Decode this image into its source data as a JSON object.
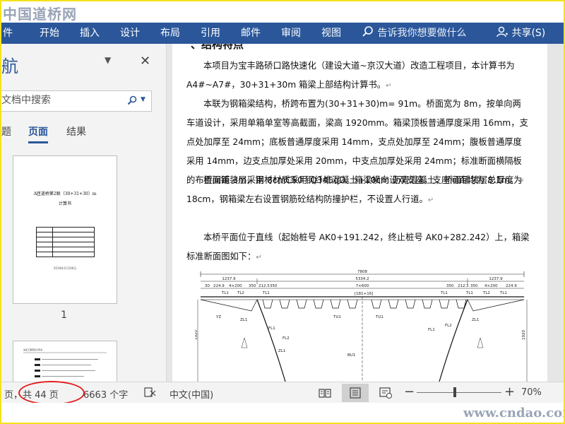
{
  "watermark": {
    "top": "中国道桥网",
    "bottom": "www.cndao.com"
  },
  "ribbon": {
    "tabs": [
      "件",
      "开始",
      "插入",
      "设计",
      "布局",
      "引用",
      "邮件",
      "审阅",
      "视图"
    ],
    "tell_me": "告诉我你想要做什么",
    "share": "共享(S)"
  },
  "nav": {
    "title": "航",
    "search_placeholder": "文档中搜索",
    "tabs": [
      "题",
      "页面",
      "结果"
    ],
    "thumb1": {
      "title": "A匝道桥第2联（30+31+30）m",
      "subtitle": "计算书",
      "date": "2018年11月06日",
      "page_number": "1"
    },
    "thumb2": {
      "header": "某某工程项目计算书"
    }
  },
  "document": {
    "heading": "、结构特点",
    "paragraphs": [
      "本项目为宝丰路硚口路快速化（建设大道~京汉大道）改造工程项目，本计算书为A4#~A7#，30+31+30m 箱梁上部结构计算书。",
      "本联为钢箱梁结构，桥跨布置为(30+31+30)m= 91m。桥面宽为 8m，按单向两车道设计，采用单箱单室等高截面，梁高 1920mm。箱梁顶板普通厚度采用 16mm，支点处加厚至 24mm；底板普通厚度采用 14mm，支点处加厚至 24mm；腹板普通厚度采用 14mm，边支点加厚处采用 20mm，中支点加厚处采用 24mm；标准断面横隔板的布置间距 3m，钢材材质采用 Q345qD。箱梁横向设双支座，支座间距均为 8.1m。",
      "桥面铺装层采用 8cmC50 钢纤维混凝土+10cm 沥青混凝土，桥面铺装层总厚度为18cm，钢箱梁左右设置钢筋砼结构防撞护栏，不设置人行道。",
      "本桥平面位于直线（起始桩号 AK0+191.242，终止桩号 AK0+282.242）上，箱梁标准断面图如下："
    ],
    "paragraph_mark": "↵",
    "drawing": {
      "overall_width": "7808",
      "left_overhang": "1237.9",
      "center_width": "5334.2",
      "right_overhang": "1237.9",
      "center_spacing": "7×600",
      "center_tag": "[181+16]",
      "dims_left": [
        "30",
        "224.9",
        "4×200",
        "350",
        "212.5",
        "350"
      ],
      "dims_right": [
        "350",
        "212.5",
        "350",
        "4×200",
        "224.9"
      ],
      "tags_top": [
        "TL1",
        "TL2",
        "TL1",
        "TL1",
        "TL1",
        "TL2",
        "TL1"
      ],
      "tags_mid": [
        "YZ",
        "ZL1",
        "TU1",
        "TU1",
        "FL1",
        "FL2",
        "ZL1"
      ],
      "tags_low": [
        "FL1",
        "FL2",
        "ZL1"
      ],
      "height_left": "1920",
      "height_right": "1920",
      "bottom_tag": "BU1"
    }
  },
  "status": {
    "page": "页，共 44 页",
    "words": "6663 个字",
    "language": "中文(中国)",
    "zoom": "70%",
    "zoom_fraction": 0.45
  }
}
